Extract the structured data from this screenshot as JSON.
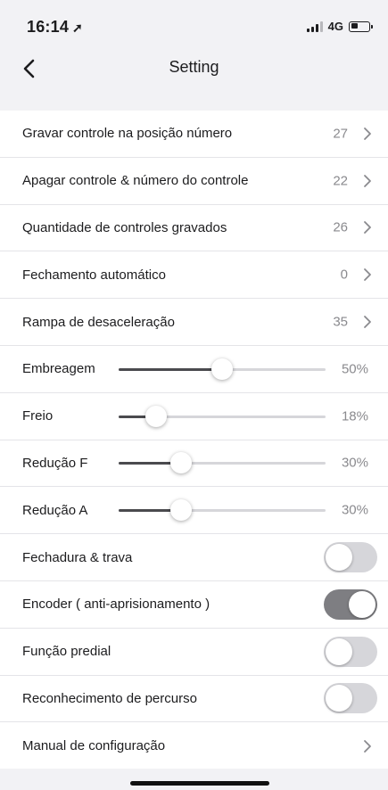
{
  "status_bar": {
    "time": "16:14",
    "location_glyph": "➚",
    "network": "4G"
  },
  "nav": {
    "title": "Setting",
    "back_icon": "chevron-left-icon"
  },
  "rows": [
    {
      "label": "Gravar controle na posição número",
      "value": "27"
    },
    {
      "label": "Apagar controle & número do controle",
      "value": "22"
    },
    {
      "label": "Quantidade de controles gravados",
      "value": "26"
    },
    {
      "label": "Fechamento automático",
      "value": "0"
    },
    {
      "label": "Rampa de desaceleração",
      "value": "35"
    }
  ],
  "sliders": [
    {
      "label": "Embreagem",
      "value": "50%",
      "level": 0.5
    },
    {
      "label": "Freio",
      "value": "18%",
      "level": 0.18
    },
    {
      "label": "Redução F",
      "value": "30%",
      "level": 0.3
    },
    {
      "label": "Redução A",
      "value": "30%",
      "level": 0.3
    }
  ],
  "toggles": [
    {
      "label": "Fechadura & trava",
      "on": false
    },
    {
      "label": "Encoder ( anti-aprisionamento )",
      "on": true
    },
    {
      "label": "Função predial",
      "on": false
    },
    {
      "label": "Reconhecimento de percurso",
      "on": false
    }
  ],
  "manual": {
    "label": "Manual de configuração"
  },
  "colors": {
    "background": "#f2f2f5",
    "toggle_on": "#7e7e82",
    "toggle_off": "#d6d6da",
    "slider_fill": "#4a4a4e"
  }
}
